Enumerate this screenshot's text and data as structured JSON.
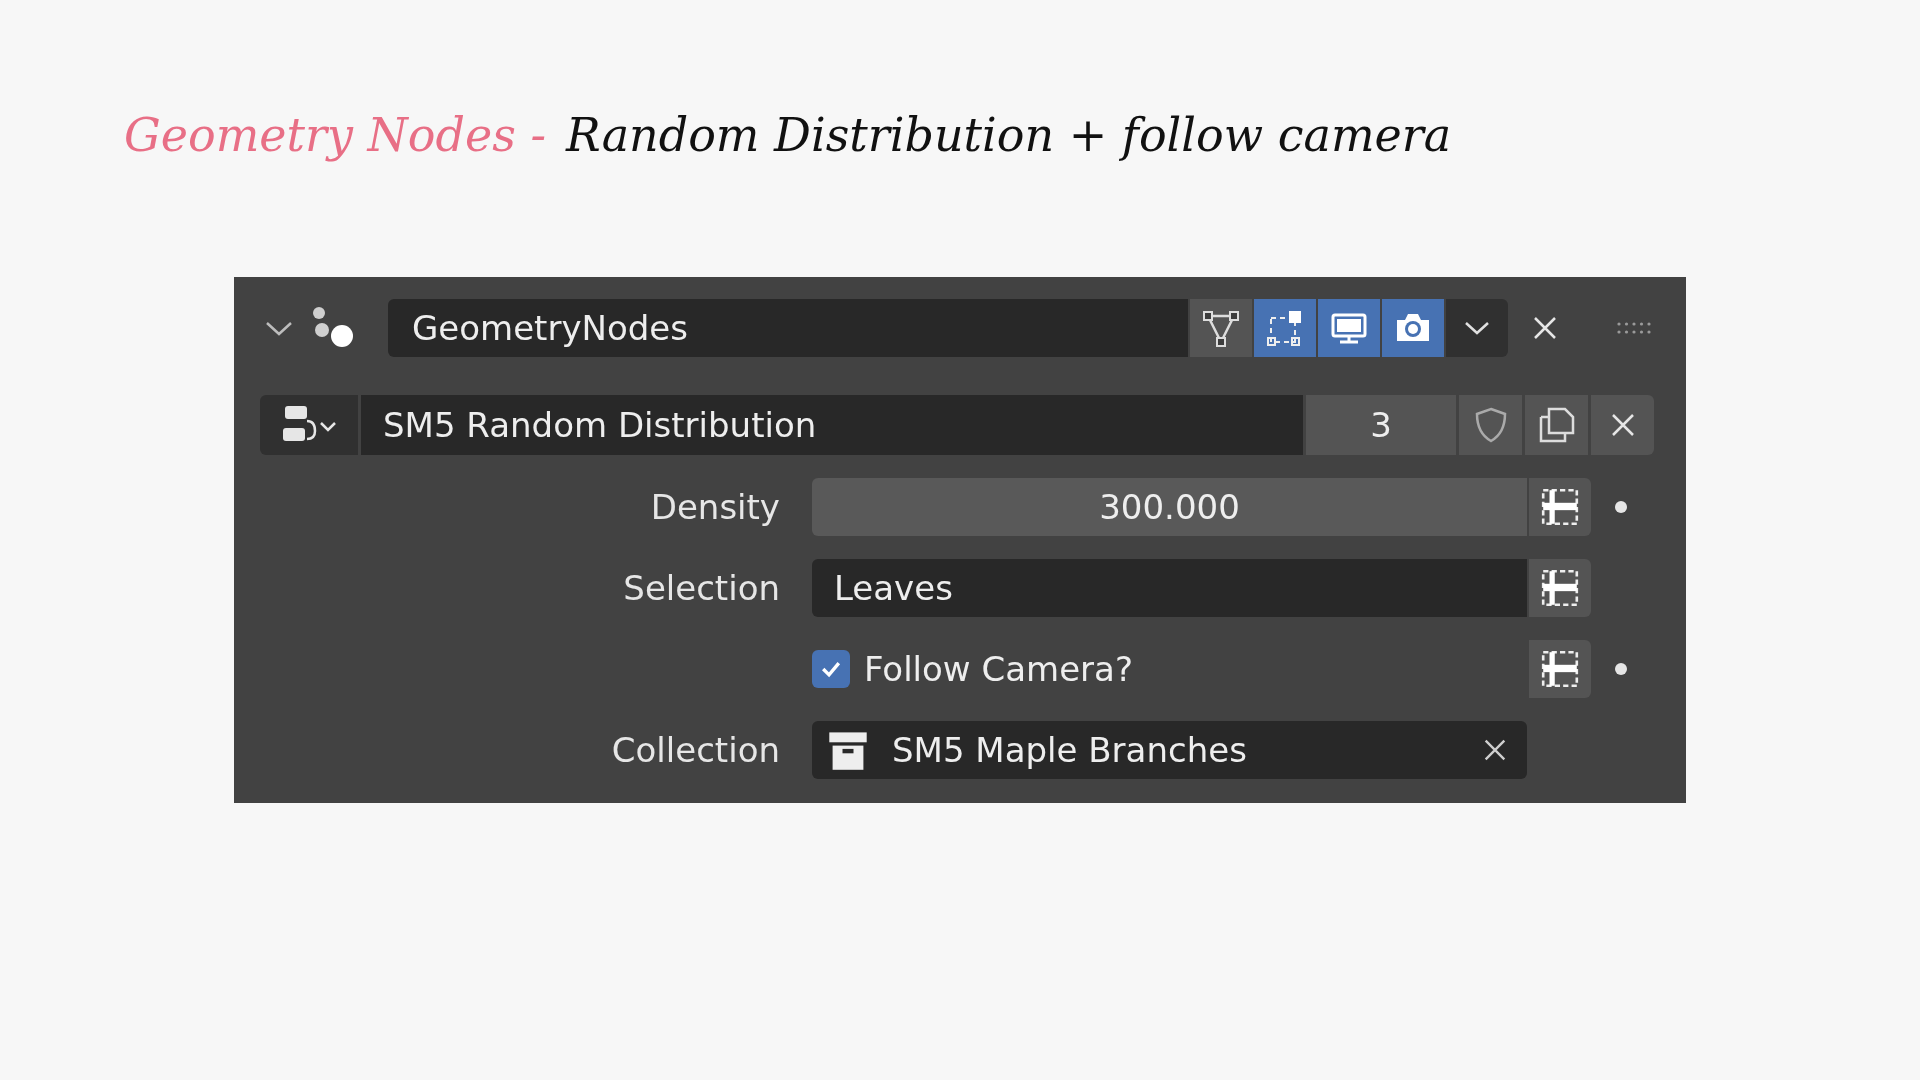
{
  "slide_title": {
    "accent": "Geometry Nodes -",
    "rest": "Random Distribution + follow camera"
  },
  "modifier": {
    "expanded": true,
    "name": "GeometryNodes",
    "toggles": [
      {
        "kind": "cage",
        "selected": false
      },
      {
        "kind": "editmode",
        "selected": true
      },
      {
        "kind": "viewport",
        "selected": true
      },
      {
        "kind": "render",
        "selected": true
      }
    ]
  },
  "node_group": {
    "name": "SM5 Random Distribution",
    "users": "3",
    "fake_user": false
  },
  "properties": [
    {
      "kind": "number",
      "label": "Density",
      "value": "300.000",
      "keyframe_dot": true
    },
    {
      "kind": "text",
      "label": "Selection",
      "value": "Leaves",
      "keyframe_dot": false
    },
    {
      "kind": "checkbox",
      "label": "Follow Camera?",
      "checked": true,
      "keyframe_dot": true
    },
    {
      "kind": "object",
      "label": "Collection",
      "value": "SM5 Maple Branches"
    }
  ]
}
